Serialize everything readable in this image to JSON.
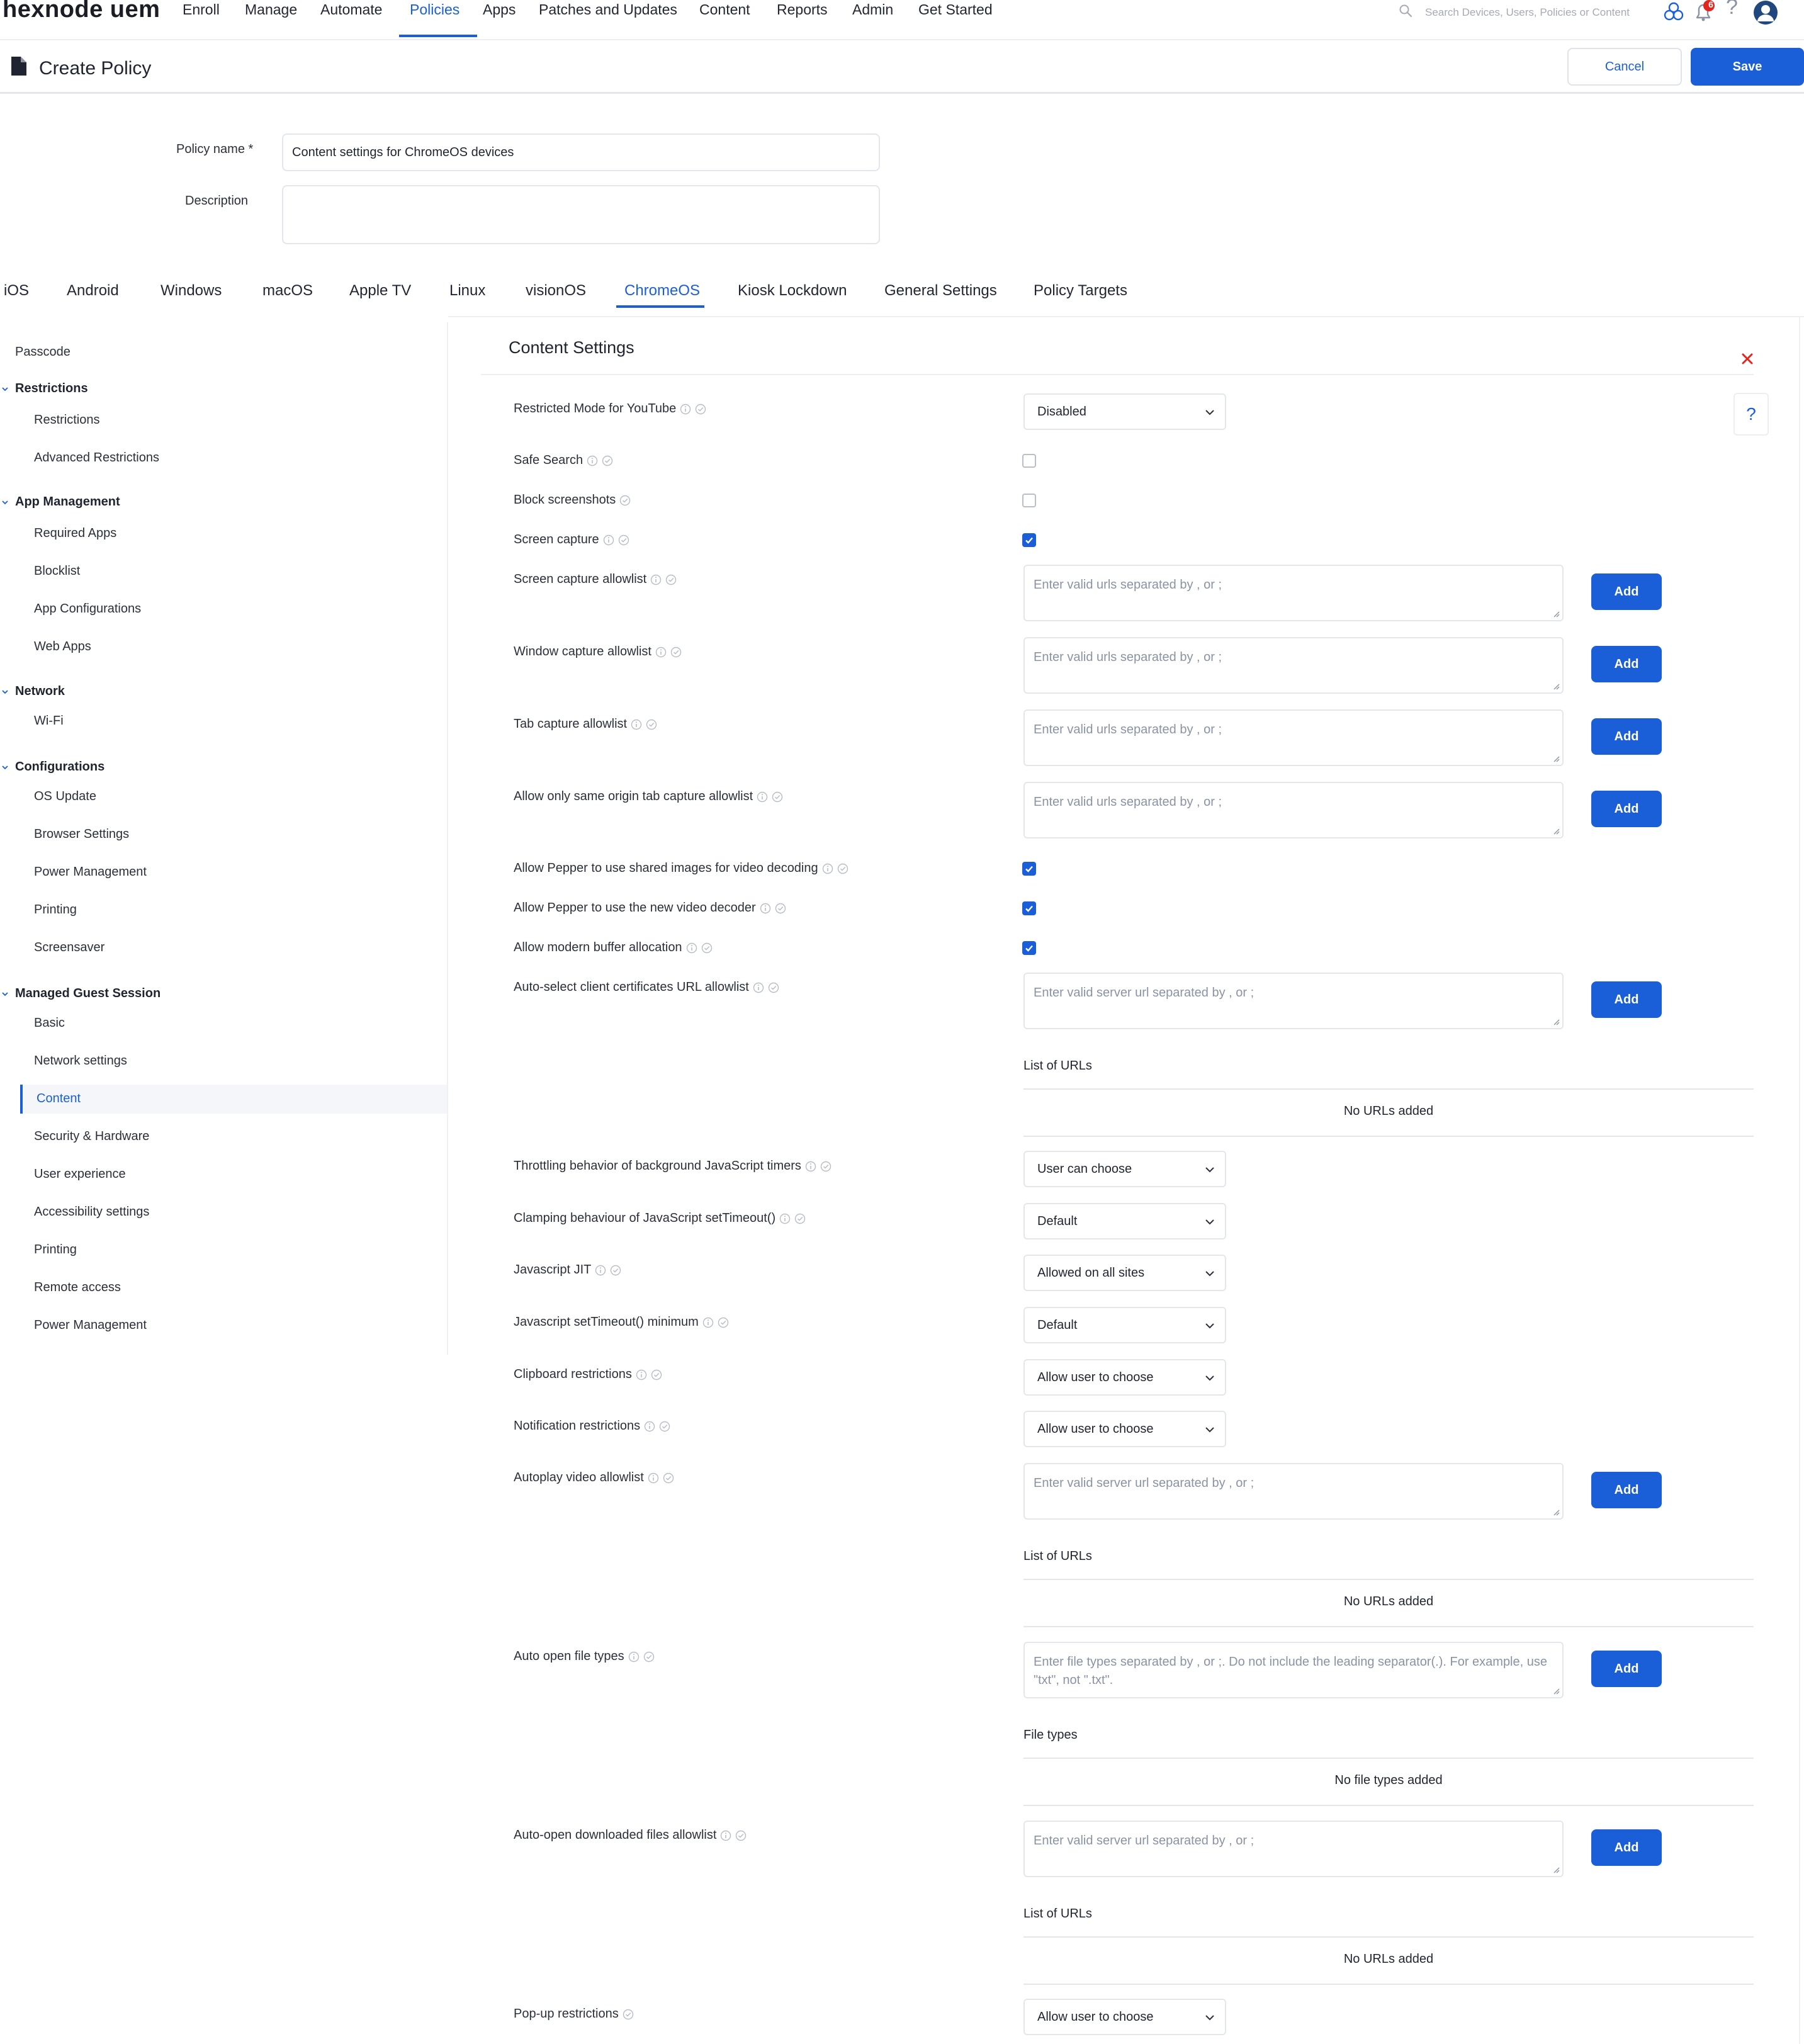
{
  "app": {
    "logo": "hexnode uem"
  },
  "nav": {
    "items": [
      "Enroll",
      "Manage",
      "Automate",
      "Policies",
      "Apps",
      "Patches and Updates",
      "Content",
      "Reports",
      "Admin",
      "Get Started"
    ],
    "active": "Policies",
    "search_placeholder": "Search Devices, Users, Policies or Content",
    "notification_count": "6"
  },
  "header": {
    "title": "Create Policy",
    "cancel_label": "Cancel",
    "save_label": "Save"
  },
  "form": {
    "policy_name_label": "Policy name *",
    "policy_name_value": "Content settings for ChromeOS devices",
    "description_label": "Description",
    "description_value": ""
  },
  "os_tabs": [
    "iOS",
    "Android",
    "Windows",
    "macOS",
    "Apple TV",
    "Linux",
    "visionOS",
    "ChromeOS",
    "Kiosk Lockdown",
    "General Settings",
    "Policy Targets"
  ],
  "os_tab_active": "ChromeOS",
  "sidebar": {
    "passcode": "Passcode",
    "groups": [
      {
        "title": "Restrictions",
        "items": [
          "Restrictions",
          "Advanced Restrictions"
        ]
      },
      {
        "title": "App Management",
        "items": [
          "Required Apps",
          "Blocklist",
          "App Configurations",
          "Web Apps"
        ]
      },
      {
        "title": "Network",
        "items": [
          "Wi-Fi"
        ]
      },
      {
        "title": "Configurations",
        "items": [
          "OS Update",
          "Browser Settings",
          "Power Management",
          "Printing",
          "Screensaver"
        ]
      },
      {
        "title": "Managed Guest Session",
        "items": [
          "Basic",
          "Network settings",
          "Content",
          "Security & Hardware",
          "User experience",
          "Accessibility settings",
          "Printing",
          "Remote access",
          "Power Management"
        ]
      }
    ],
    "active_item": "Content"
  },
  "panel": {
    "title": "Content Settings",
    "help": "?",
    "rows": [
      {
        "label": "Restricted Mode for YouTube",
        "info": true,
        "control": "select",
        "value": "Disabled"
      },
      {
        "label": "Safe Search",
        "info": true,
        "control": "checkbox",
        "checked": false
      },
      {
        "label": "Block screenshots",
        "info": false,
        "control": "checkbox",
        "checked": false
      },
      {
        "label": "Screen capture",
        "info": true,
        "control": "checkbox",
        "checked": true
      },
      {
        "label": "Screen capture allowlist",
        "info": true,
        "control": "textarea",
        "placeholder": "Enter valid urls separated by , or ;",
        "button": "Add"
      },
      {
        "label": "Window capture allowlist",
        "info": true,
        "control": "textarea",
        "placeholder": "Enter valid urls separated by , or ;",
        "button": "Add"
      },
      {
        "label": "Tab capture allowlist",
        "info": true,
        "control": "textarea",
        "placeholder": "Enter valid urls separated by , or ;",
        "button": "Add"
      },
      {
        "label": "Allow only same origin tab capture allowlist",
        "info": true,
        "control": "textarea",
        "placeholder": "Enter valid urls separated by , or ;",
        "button": "Add"
      },
      {
        "label": "Allow Pepper to use shared images for video decoding",
        "info": true,
        "control": "checkbox",
        "checked": true
      },
      {
        "label": "Allow Pepper to use the new video decoder",
        "info": true,
        "control": "checkbox",
        "checked": true
      },
      {
        "label": "Allow modern buffer allocation",
        "info": true,
        "control": "checkbox",
        "checked": true
      },
      {
        "label": "Auto-select client certificates URL allowlist",
        "info": true,
        "control": "textarea",
        "placeholder": "Enter valid server url separated by , or ;",
        "button": "Add",
        "list_title": "List of URLs",
        "list_empty": "No URLs added"
      },
      {
        "label": "Throttling behavior of background JavaScript timers",
        "info": true,
        "control": "select",
        "value": "User can choose"
      },
      {
        "label": "Clamping behaviour of JavaScript setTimeout()",
        "info": true,
        "control": "select",
        "value": "Default"
      },
      {
        "label": "Javascript JIT",
        "info": true,
        "control": "select",
        "value": "Allowed on all sites"
      },
      {
        "label": "Javascript setTimeout() minimum",
        "info": true,
        "control": "select",
        "value": "Default"
      },
      {
        "label": "Clipboard restrictions",
        "info": true,
        "control": "select",
        "value": "Allow user to choose"
      },
      {
        "label": "Notification restrictions",
        "info": true,
        "control": "select",
        "value": "Allow user to choose"
      },
      {
        "label": "Autoplay video allowlist",
        "info": true,
        "control": "textarea",
        "placeholder": "Enter valid server url separated by , or ;",
        "button": "Add",
        "list_title": "List of URLs",
        "list_empty": "No URLs added"
      },
      {
        "label": "Auto open file types",
        "info": true,
        "control": "textarea",
        "placeholder": "Enter file types separated by , or ;. Do not include the leading separator(.). For example, use \"txt\", not \".txt\".",
        "button": "Add",
        "list_title": "File types",
        "list_empty": "No file types added"
      },
      {
        "label": "Auto-open downloaded files allowlist",
        "info": true,
        "control": "textarea",
        "placeholder": "Enter valid server url separated by , or ;",
        "button": "Add",
        "list_title": "List of URLs",
        "list_empty": "No URLs added"
      },
      {
        "label": "Pop-up restrictions",
        "info": false,
        "control": "select",
        "value": "Allow user to choose"
      }
    ]
  },
  "colors": {
    "accent": "#1b5fd8",
    "danger": "#e0261f"
  }
}
